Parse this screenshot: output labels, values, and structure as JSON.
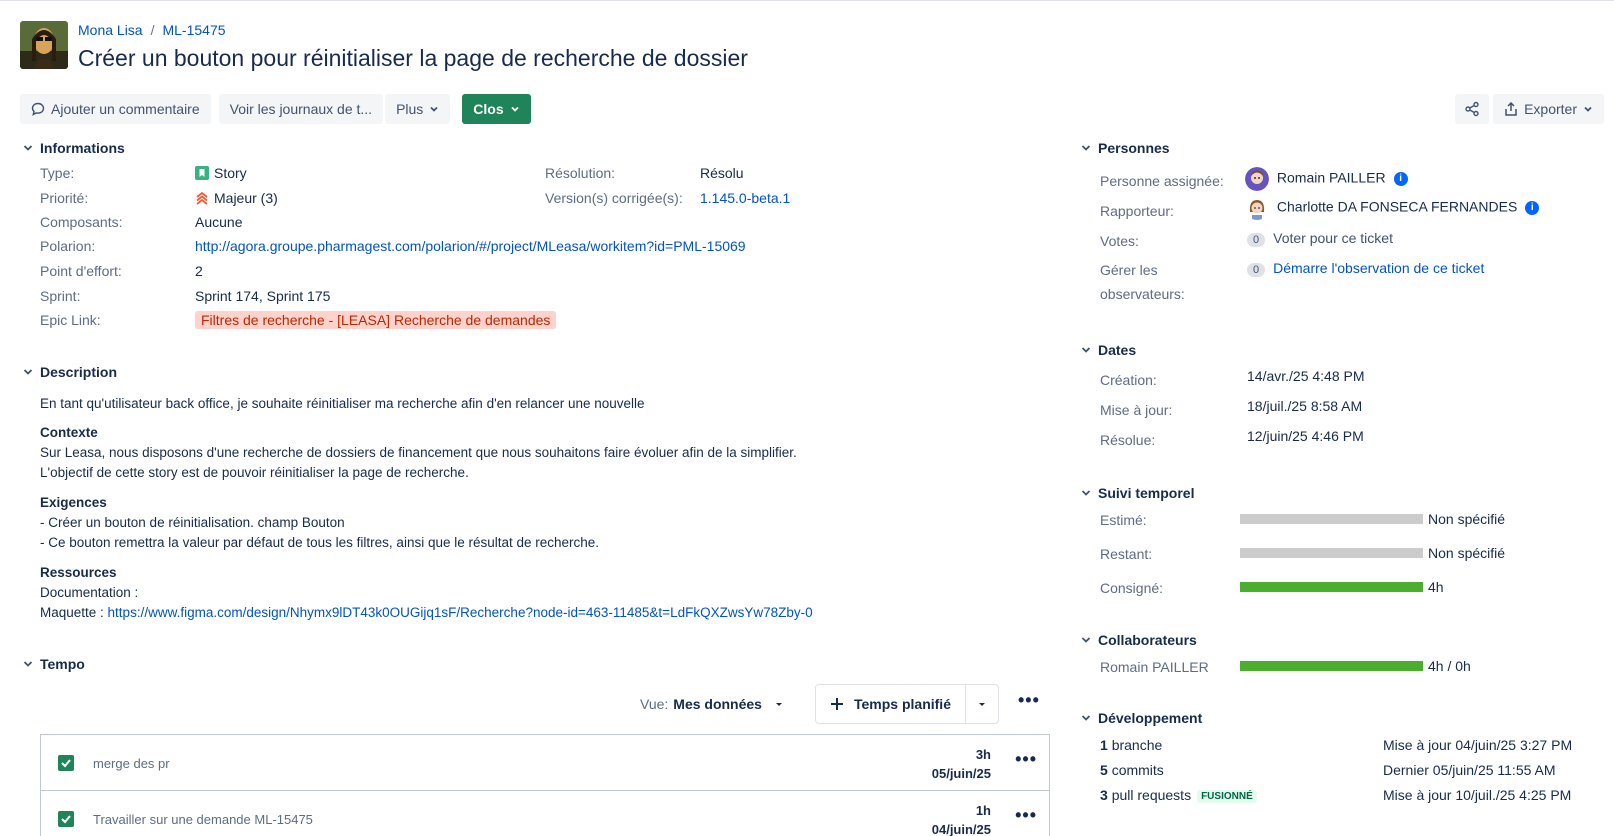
{
  "breadcrumb": {
    "project": "Mona Lisa",
    "issue_key": "ML-15475"
  },
  "issue": {
    "title": "Créer un bouton pour réinitialiser la page de recherche de dossier"
  },
  "toolbar": {
    "comment": "Ajouter un commentaire",
    "logs": "Voir les journaux de t...",
    "more": "Plus",
    "status": "Clos",
    "export": "Exporter"
  },
  "info": {
    "heading": "Informations",
    "type_label": "Type:",
    "type_value": "Story",
    "priority_label": "Priorité:",
    "priority_value": "Majeur (3)",
    "components_label": "Composants:",
    "components_value": "Aucune",
    "polarion_label": "Polarion:",
    "polarion_value": "http://agora.groupe.pharmagest.com/polarion/#/project/MLeasa/workitem?id=PML-15069",
    "effort_label": "Point d'effort:",
    "effort_value": "2",
    "sprint_label": "Sprint:",
    "sprint_value": "Sprint 174, Sprint 175",
    "epic_label": "Epic Link:",
    "epic_value": "Filtres de recherche - [LEASA] Recherche de demandes",
    "resolution_label": "Résolution:",
    "resolution_value": "Résolu",
    "fixversion_label": "Version(s) corrigée(s):",
    "fixversion_value": "1.145.0-beta.1"
  },
  "description": {
    "heading": "Description",
    "intro": "En tant qu'utilisateur back office, je souhaite réinitialiser ma recherche afin d'en relancer une nouvelle",
    "context_title": "Contexte",
    "context_1": "Sur Leasa, nous disposons d'une recherche de dossiers de financement que nous souhaitons faire évoluer afin de la simplifier.",
    "context_2": "L'objectif de cette story est de pouvoir réinitialiser la page de recherche.",
    "req_title": "Exigences",
    "req_1": "- Créer un bouton de réinitialisation. champ Bouton",
    "req_2": "- Ce bouton remettra la valeur par défaut de tous les filtres, ainsi que le résultat de recherche.",
    "res_title": "Ressources",
    "res_doc": "Documentation :",
    "res_maquette_label": "Maquette : ",
    "res_maquette_link": "https://www.figma.com/design/Nhymx9lDT43k0OUGijq1sF/Recherche?node-id=463-11485&t=LdFkQXZwsYw78Zby-0"
  },
  "tempo": {
    "heading": "Tempo",
    "view_label": "Vue:",
    "view_value": "Mes données",
    "planned_button": "Temps planifié",
    "rows": [
      {
        "text": "merge des pr",
        "hours": "3h",
        "date": "05/juin/25"
      },
      {
        "text": "Travailler sur une demande ML-15475",
        "hours": "1h",
        "date": "04/juin/25"
      }
    ]
  },
  "people": {
    "heading": "Personnes",
    "assignee_label": "Personne assignée:",
    "assignee_value": "Romain PAILLER",
    "reporter_label": "Rapporteur:",
    "reporter_value": "Charlotte DA FONSECA FERNANDES",
    "votes_label": "Votes:",
    "votes_count": "0",
    "votes_action": "Voter pour ce ticket",
    "watchers_label_1": "Gérer les",
    "watchers_label_2": "observateurs:",
    "watchers_count": "0",
    "watchers_action": "Démarre l'observation de ce ticket"
  },
  "dates": {
    "heading": "Dates",
    "created_label": "Création:",
    "created_value": "14/avr./25 4:48 PM",
    "updated_label": "Mise à jour:",
    "updated_value": "18/juil./25 8:58 AM",
    "resolved_label": "Résolue:",
    "resolved_value": "12/juin/25 4:46 PM"
  },
  "time_tracking": {
    "heading": "Suivi temporel",
    "estimated_label": "Estimé:",
    "estimated_value": "Non spécifié",
    "estimated_fraction": 0,
    "remaining_label": "Restant:",
    "remaining_value": "Non spécifié",
    "remaining_fraction": 0,
    "logged_label": "Consigné:",
    "logged_value": "4h",
    "logged_fraction": 1
  },
  "collaborators": {
    "heading": "Collaborateurs",
    "name": "Romain PAILLER",
    "value": "4h / 0h",
    "fraction": 1
  },
  "development": {
    "heading": "Développement",
    "branch_count": "1",
    "branch_label": "branche",
    "branch_status": "Mise à jour 04/juin/25 3:27 PM",
    "commits_count": "5",
    "commits_label": "commits",
    "commits_status": "Dernier 05/juin/25 11:55 AM",
    "pr_count": "3",
    "pr_label": "pull requests",
    "pr_badge": "FUSIONNÉ",
    "pr_status": "Mise à jour 10/juil./25 4:25 PM"
  },
  "colors": {
    "accent": "#0052cc",
    "success": "#1f845a",
    "bar_logged": "#4bae2e",
    "bar_empty": "#cccccc",
    "epic_bg": "#ffd2cc"
  }
}
